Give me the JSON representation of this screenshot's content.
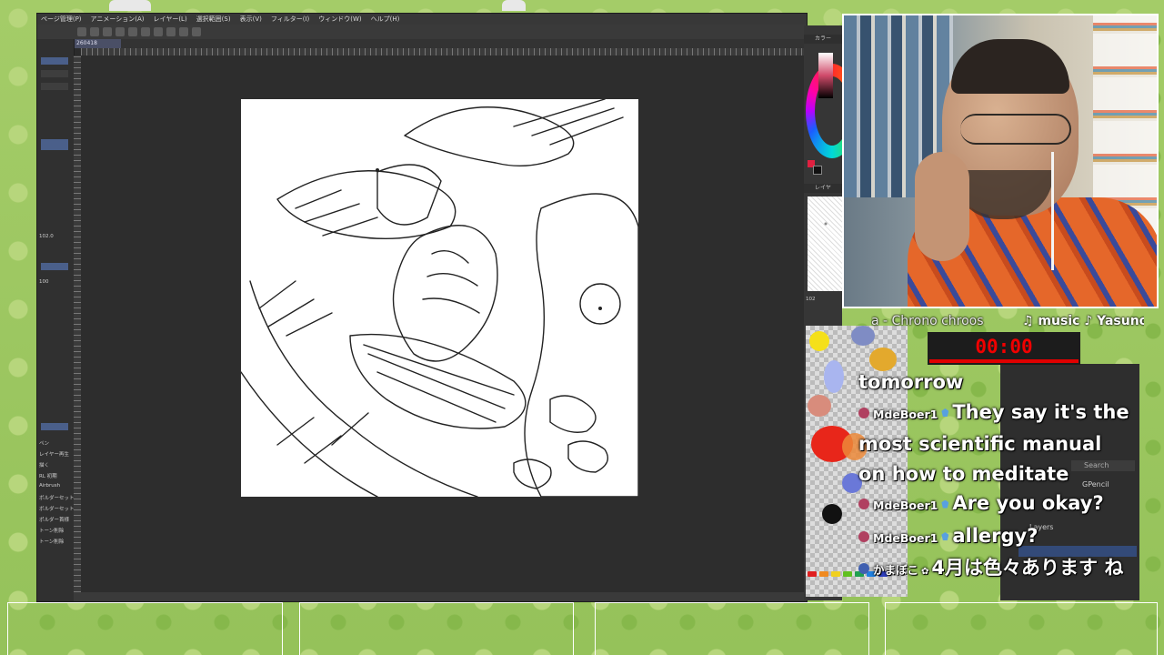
{
  "app": {
    "menu": [
      "ページ管理(P)",
      "アニメーション(A)",
      "レイヤー(L)",
      "選択範囲(S)",
      "表示(V)",
      "フィルター(I)",
      "ウィンドウ(W)",
      "ヘルプ(H)"
    ],
    "doc_tab": "260418",
    "left_panel": {
      "zoom": "102.0",
      "brush_size": "100",
      "labels": [
        "ペン",
        "レイヤー再生",
        "描く",
        "RL 初期",
        "Airbrush",
        "ボルダーセット",
        "ボルダーセット",
        "ポルダー首様",
        "トーン削除",
        "トーン削除"
      ]
    },
    "right_panel": {
      "color_tab": "カラー",
      "layer_tab": "レイヤ",
      "zoom_label": "102"
    }
  },
  "stream": {
    "ticker_left": "a - Chrono chroos",
    "ticker_right": "♫ music ♪ Yasuno",
    "timer": "00:00"
  },
  "overlay_panel": {
    "search_placeholder": "Search",
    "brush_name": "GPencil",
    "layers_label": "Layers"
  },
  "chat": [
    {
      "user": "",
      "message": "tomorrow"
    },
    {
      "user": "MdeBoer1",
      "message": "They say it's the most scientific manual on how to meditate"
    },
    {
      "user": "MdeBoer1",
      "message": "Are you okay?"
    },
    {
      "user": "MdeBoer1",
      "message": "allergy?"
    },
    {
      "user": "かまぼこ",
      "message": "4月は色々あります ね"
    }
  ],
  "colors": {
    "accent_red": "#e00000",
    "brand_bg": "#9cc460",
    "app_bg": "#2b2b2b"
  }
}
